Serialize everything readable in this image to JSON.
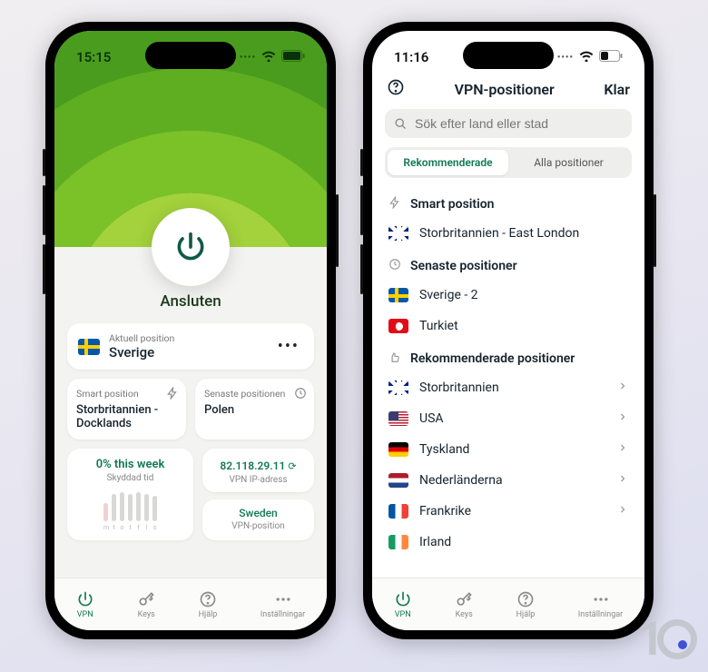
{
  "left": {
    "status_time": "15:15",
    "connected_label": "Ansluten",
    "current_location": {
      "caption": "Aktuell position",
      "country": "Sverige"
    },
    "smart": {
      "caption": "Smart position",
      "value": "Storbritannien - Docklands"
    },
    "recent": {
      "caption": "Senaste positionen",
      "value": "Polen"
    },
    "stats": {
      "pct": "0% this week",
      "sub": "Skyddad tid"
    },
    "ip": {
      "value": "82.118.29.11",
      "sub": "VPN IP-adress"
    },
    "loc2": {
      "value": "Sweden",
      "sub": "VPN-position"
    },
    "tabs": {
      "vpn": "VPN",
      "keys": "Keys",
      "help": "Hjälp",
      "settings": "Inställningar"
    }
  },
  "right": {
    "status_time": "11:16",
    "header_title": "VPN-positioner",
    "done": "Klar",
    "search_placeholder": "Sök efter land eller stad",
    "seg_rec": "Rekommenderade",
    "seg_all": "Alla positioner",
    "sections": {
      "smart": {
        "title": "Smart position",
        "items": [
          {
            "flag": "uk",
            "label": "Storbritannien - East London"
          }
        ]
      },
      "recent": {
        "title": "Senaste positioner",
        "items": [
          {
            "flag": "se",
            "label": "Sverige - 2"
          },
          {
            "flag": "tr",
            "label": "Turkiet"
          }
        ]
      },
      "recommended": {
        "title": "Rekommenderade positioner",
        "items": [
          {
            "flag": "uk",
            "label": "Storbritannien",
            "chev": true
          },
          {
            "flag": "us",
            "label": "USA",
            "chev": true
          },
          {
            "flag": "de",
            "label": "Tyskland",
            "chev": true
          },
          {
            "flag": "nl",
            "label": "Nederländerna",
            "chev": true
          },
          {
            "flag": "fr",
            "label": "Frankrike",
            "chev": true
          },
          {
            "flag": "ie",
            "label": "Irland"
          }
        ]
      }
    },
    "tabs": {
      "vpn": "VPN",
      "keys": "Keys",
      "help": "Hjälp",
      "settings": "Inställningar"
    }
  }
}
